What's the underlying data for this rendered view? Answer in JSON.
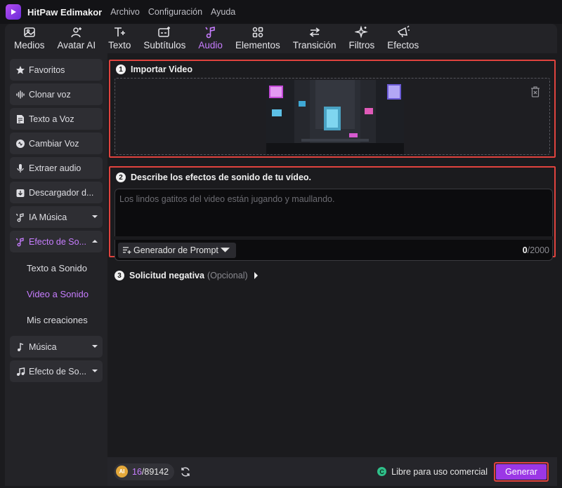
{
  "app": {
    "name": "HitPaw Edimakor",
    "menu": [
      "Archivo",
      "Configuración",
      "Ayuda"
    ]
  },
  "toolbar": {
    "tabs": [
      {
        "label": "Medios",
        "icon": "media-icon"
      },
      {
        "label": "Avatar AI",
        "icon": "avatar-icon"
      },
      {
        "label": "Texto",
        "icon": "text-icon"
      },
      {
        "label": "Subtítulos",
        "icon": "subtitles-icon"
      },
      {
        "label": "Audio",
        "icon": "audio-icon",
        "active": true
      },
      {
        "label": "Elementos",
        "icon": "elements-icon"
      },
      {
        "label": "Transición",
        "icon": "transition-icon"
      },
      {
        "label": "Filtros",
        "icon": "filters-icon"
      },
      {
        "label": "Efectos",
        "icon": "effects-icon"
      }
    ]
  },
  "sidebar": {
    "items": [
      {
        "label": "Favoritos",
        "icon": "star-icon"
      },
      {
        "label": "Clonar voz",
        "icon": "voice-wave-icon"
      },
      {
        "label": "Texto a Voz",
        "icon": "document-voice-icon"
      },
      {
        "label": "Cambiar Voz",
        "icon": "voice-change-icon"
      },
      {
        "label": "Extraer audio",
        "icon": "microphone-icon"
      },
      {
        "label": "Descargador d...",
        "icon": "download-icon"
      },
      {
        "label": "IA Música",
        "icon": "ai-music-icon",
        "expandable": true
      },
      {
        "label": "Efecto de So...",
        "icon": "sound-effect-icon",
        "expandable": true,
        "expanded": true,
        "active": true
      }
    ],
    "sub_items": [
      {
        "label": "Texto a Sonido"
      },
      {
        "label": "Video a Sonido",
        "active": true
      },
      {
        "label": "Mis creaciones"
      }
    ],
    "items_after": [
      {
        "label": "Música",
        "icon": "music-note-icon",
        "expandable": true
      },
      {
        "label": "Efecto de So...",
        "icon": "sound-effect-icon",
        "expandable": true
      }
    ]
  },
  "import_section": {
    "number": "1",
    "title": "Importar Video"
  },
  "describe_section": {
    "number": "2",
    "title": "Describe los efectos de sonido de tu vídeo.",
    "placeholder": "Los lindos gatitos del video están jugando y maullando.",
    "prompt_button": "Generador de Prompt",
    "count_current": "0",
    "count_max": "/2000"
  },
  "negative_section": {
    "number": "3",
    "title": "Solicitud negativa",
    "optional": "(Opcional)"
  },
  "footer": {
    "credits_badge": "AI",
    "credits_used": "16",
    "credits_total": "/89142",
    "license_icon": "C",
    "license_text": "Libre para uso comercial",
    "generate_label": "Generar"
  },
  "colors": {
    "accent": "#c77dff",
    "generate": "#9b37e6",
    "highlight_border": "#e0433e",
    "license_green": "#2fc08a"
  }
}
